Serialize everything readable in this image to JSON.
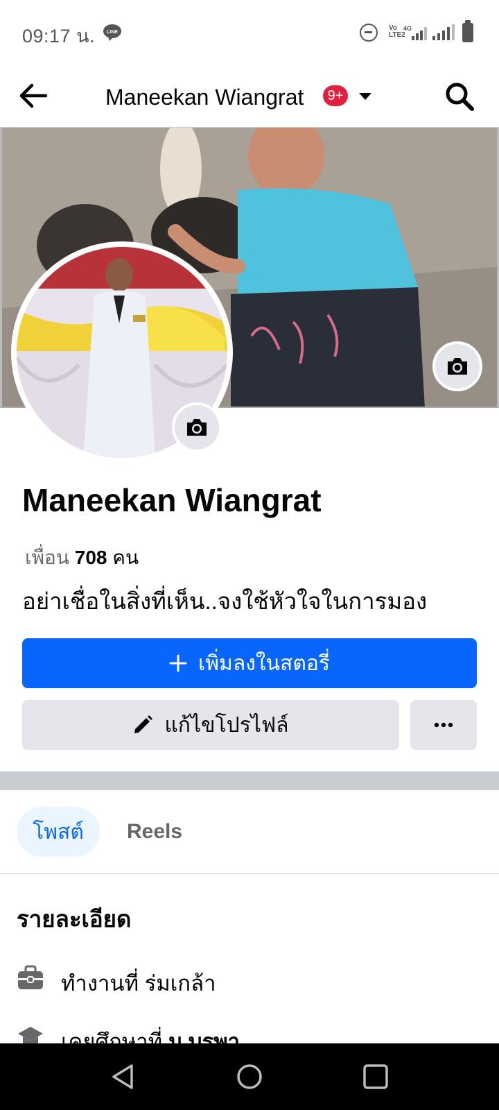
{
  "status_bar": {
    "time": "09:17 น.",
    "line_badge": "LINE",
    "volte_label": "Vo\nLTE2",
    "network_label": "4G"
  },
  "header": {
    "title": "Maneekan Wiangrat",
    "notification_badge": "9+"
  },
  "profile": {
    "name": "Maneekan Wiangrat",
    "friends_label": "เพื่อน",
    "friends_count": "708",
    "friends_unit": "คน",
    "bio": "อย่าเชื่อในสิ่งที่เห็น..จงใช้หัวใจในการมอง"
  },
  "actions": {
    "add_story_label": "เพิ่มลงในสตอรี่",
    "edit_profile_label": "แก้ไขโปรไฟล์"
  },
  "tabs": [
    {
      "label": "โพสต์",
      "active": true
    },
    {
      "label": "Reels",
      "active": false
    }
  ],
  "details": {
    "title": "รายละเอียด",
    "items": [
      {
        "icon": "briefcase-icon",
        "prefix": "ทำงานที่ ",
        "value": "ร่มเกล้า"
      },
      {
        "icon": "graduation-cap-icon",
        "prefix": "เคยศึกษาที่ ",
        "value": "ม.บูรพา"
      }
    ]
  },
  "colors": {
    "primary": "#0866ff",
    "secondary_button": "#e4e6eb",
    "badge": "#e41e3f",
    "tab_active_bg": "#ebf5ff"
  }
}
